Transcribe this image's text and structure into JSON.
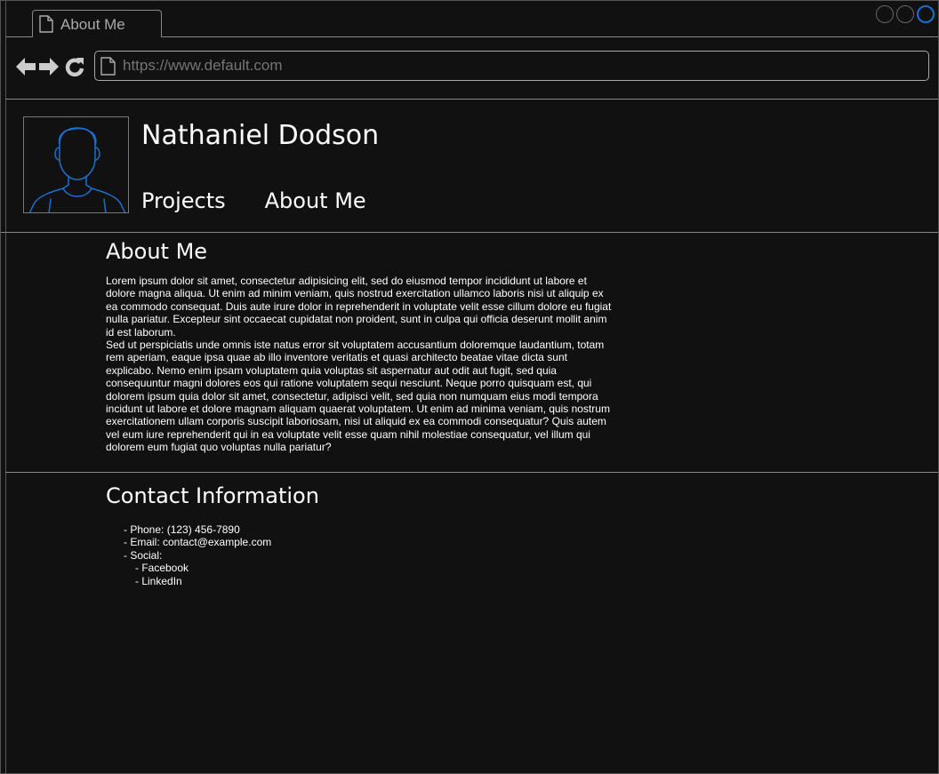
{
  "browser": {
    "tab_title": "About Me",
    "url_placeholder": "https://www.default.com",
    "icons": {
      "back": "arrow-left-icon",
      "forward": "arrow-right-icon",
      "reload": "reload-icon",
      "page": "document-icon"
    }
  },
  "colors": {
    "background": "#111111",
    "text": "#ffffff",
    "line": "#888888",
    "accent": "#1a6fd0"
  },
  "header": {
    "name": "Nathaniel Dodson",
    "nav": [
      {
        "label": "Projects"
      },
      {
        "label": "About Me"
      }
    ]
  },
  "about": {
    "title": "About Me",
    "paragraphs": [
      "Lorem ipsum dolor sit amet, consectetur adipisicing elit, sed do eiusmod tempor incididunt ut labore et dolore magna aliqua. Ut enim ad minim veniam, quis nostrud exercitation ullamco laboris nisi ut aliquip ex ea commodo consequat. Duis aute irure dolor in reprehenderit in voluptate velit esse cillum dolore eu fugiat nulla pariatur. Excepteur sint occaecat cupidatat non proident, sunt in culpa qui officia deserunt mollit anim id est laborum.",
      "Sed ut perspiciatis unde omnis iste natus error sit voluptatem accusantium doloremque laudantium, totam rem aperiam, eaque ipsa quae ab illo inventore veritatis et quasi architecto beatae vitae dicta sunt explicabo. Nemo enim ipsam voluptatem quia voluptas sit aspernatur aut odit aut fugit, sed quia consequuntur magni dolores eos qui ratione voluptatem sequi nesciunt. Neque porro quisquam est, qui dolorem ipsum quia dolor sit amet, consectetur, adipisci velit, sed quia non numquam eius modi tempora incidunt ut labore et dolore magnam aliquam quaerat voluptatem. Ut enim ad minima veniam, quis nostrum exercitationem ullam corporis suscipit laboriosam, nisi ut aliquid ex ea commodi consequatur? Quis autem vel eum iure reprehenderit qui in ea voluptate velit esse quam nihil molestiae consequatur, vel illum qui dolorem eum fugiat quo voluptas nulla pariatur?"
    ]
  },
  "contact": {
    "title": "Contact Information",
    "phone": "- Phone: (123) 456-7890",
    "email": "- Email: contact@example.com",
    "social": "- Social:",
    "social_items": [
      {
        "label": "- Facebook"
      },
      {
        "label": "- LinkedIn"
      }
    ]
  }
}
